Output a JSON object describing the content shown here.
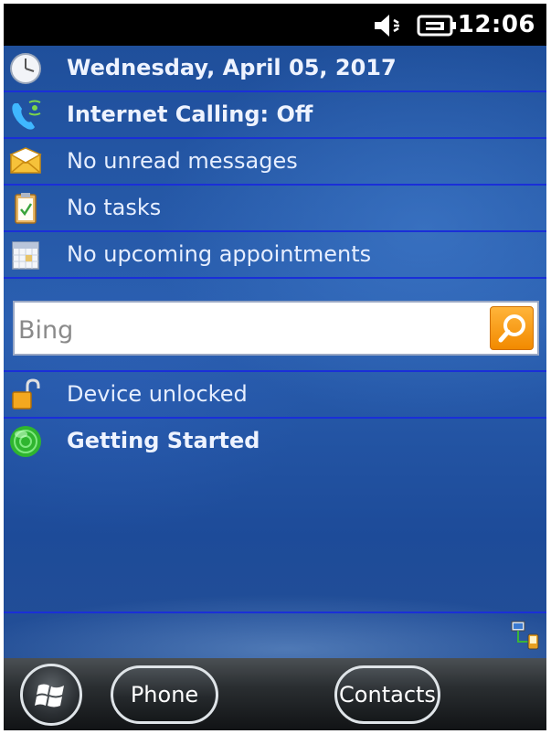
{
  "status": {
    "time": "12:06",
    "icons": [
      "speaker-muted-icon",
      "battery-charging-icon"
    ]
  },
  "today": {
    "items": [
      {
        "label": "Wednesday, April 05, 2017",
        "icon": "clock-icon",
        "bold": true
      },
      {
        "label": "Internet Calling: Off",
        "icon": "internet-calling-icon",
        "bold": true
      },
      {
        "label": "No unread messages",
        "icon": "envelope-icon",
        "bold": false
      },
      {
        "label": "No tasks",
        "icon": "clipboard-icon",
        "bold": false
      },
      {
        "label": "No upcoming appointments",
        "icon": "calendar-icon",
        "bold": false
      }
    ],
    "search": {
      "placeholder": "Bing",
      "value": "",
      "button_icon": "search-icon"
    },
    "lower_items": [
      {
        "label": "Device unlocked",
        "icon": "padlock-open-icon",
        "bold": false
      },
      {
        "label": "Getting Started",
        "icon": "green-orb-icon",
        "bold": true
      }
    ],
    "network_icon": "network-sync-icon"
  },
  "softkeys": {
    "start_icon": "windows-logo-icon",
    "left": "Phone",
    "right": "Contacts"
  },
  "colors": {
    "background_blue": "#2a5fb0",
    "separator": "#1a2fd8",
    "search_accent": "#f28a00"
  }
}
